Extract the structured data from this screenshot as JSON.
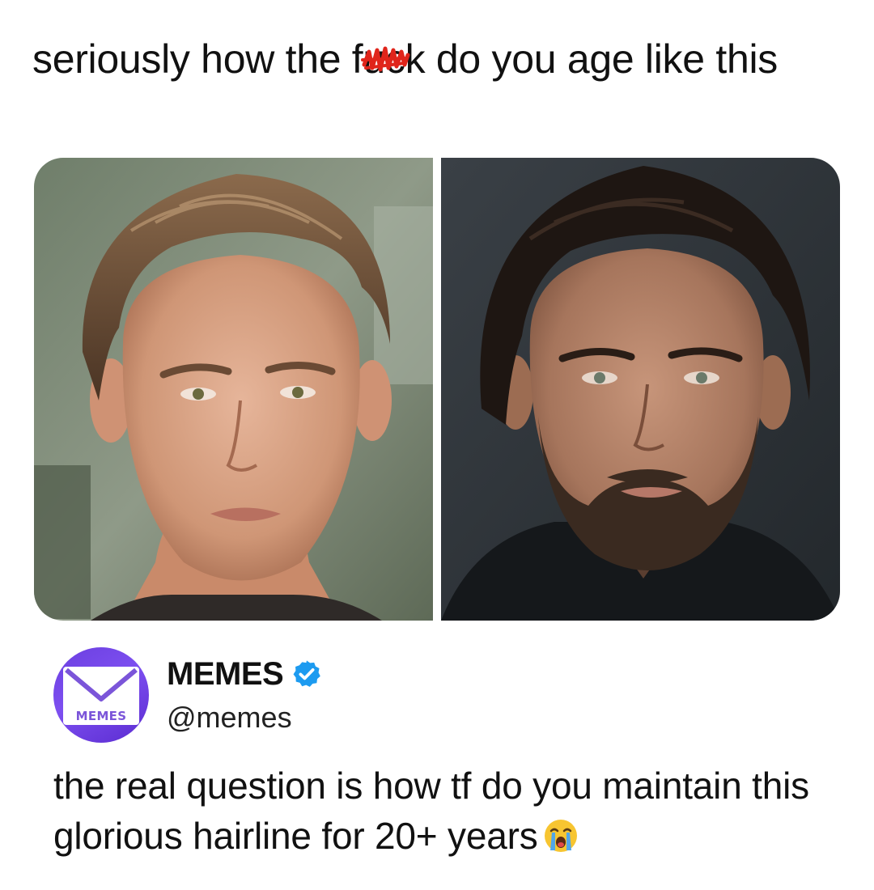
{
  "caption": {
    "before_censor": "seriously how the f",
    "censored_part": "uck",
    "after_censor": " do you age like this"
  },
  "photos": [
    {
      "name": "young-portrait"
    },
    {
      "name": "older-portrait"
    }
  ],
  "reply": {
    "avatar_text": "MEMES",
    "display_name": "MEMES",
    "handle": "@memes",
    "text": "the real question is how tf do you maintain this glorious hairline for 20+ years",
    "emoji_icon": "loudly-crying-face-icon"
  },
  "colors": {
    "scribble": "#e0251b",
    "verified": "#1d9bf0",
    "avatar": "#6b3fe0"
  }
}
